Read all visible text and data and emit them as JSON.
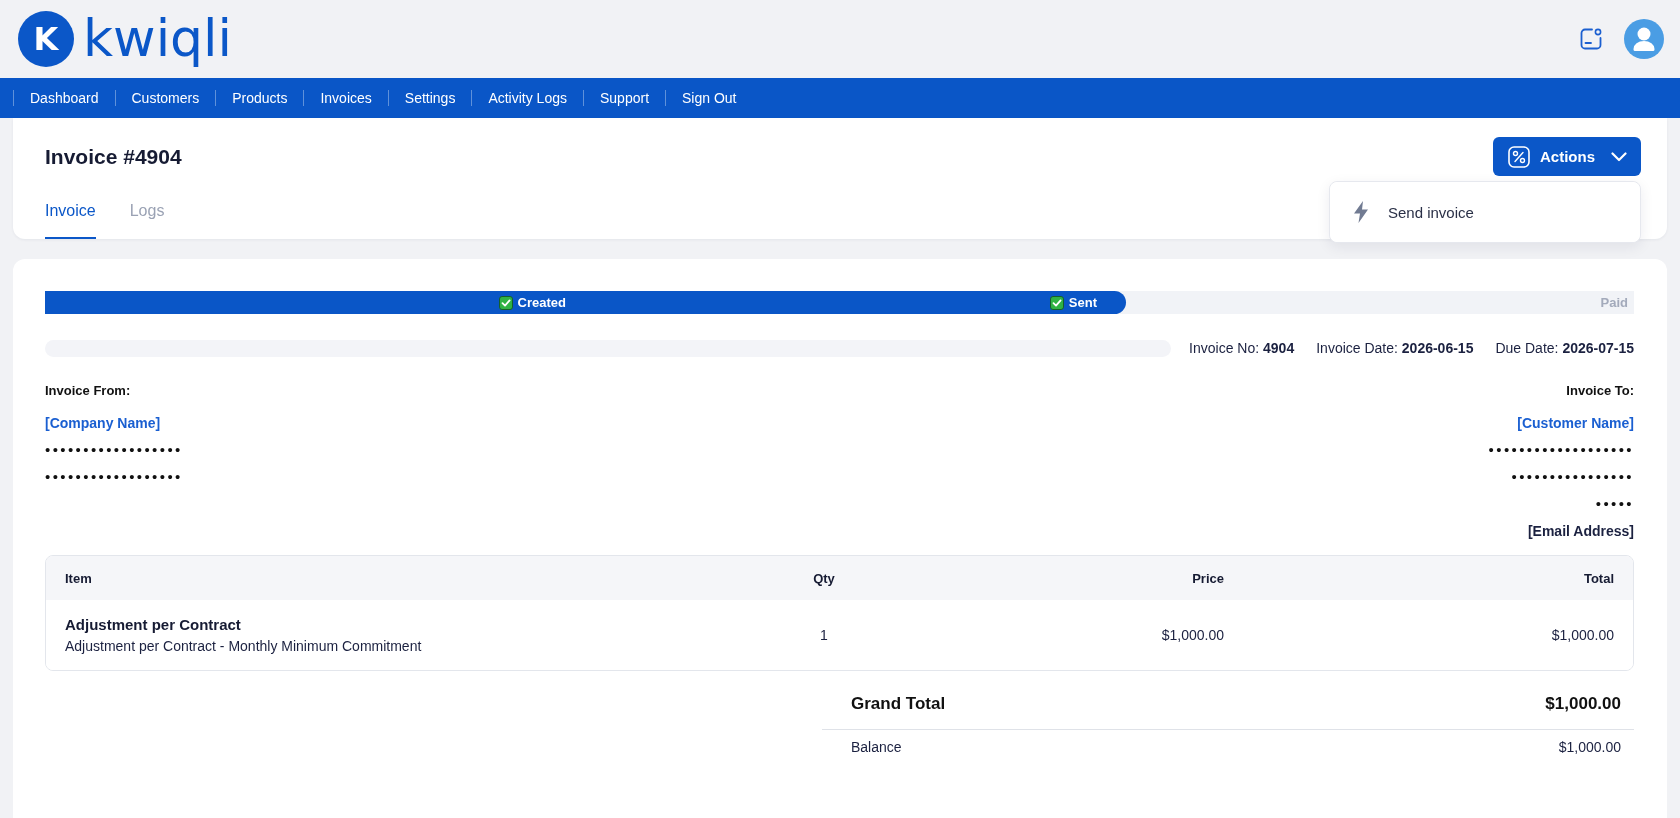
{
  "header": {
    "logo": {
      "mark": "K",
      "name": "kwiqli"
    }
  },
  "nav": [
    "Dashboard",
    "Customers",
    "Products",
    "Invoices",
    "Settings",
    "Activity Logs",
    "Support",
    "Sign Out"
  ],
  "page": {
    "title": "Invoice #4904",
    "tabs": [
      {
        "label": "Invoice",
        "selected": true
      },
      {
        "label": "Logs",
        "selected": false
      }
    ],
    "actions_button": "Actions",
    "actions_menu": {
      "open": true,
      "items": [
        "Send invoice"
      ]
    }
  },
  "progress": {
    "level": 0.68,
    "steps": [
      {
        "label": "Created",
        "done": true
      },
      {
        "label": "Sent",
        "done": true
      },
      {
        "label": "Paid",
        "done": false
      }
    ]
  },
  "meta": [
    "Invoice No: **4904**",
    "Invoice Date: **2026-06-15**",
    "Due Date: **2026-07-15**"
  ],
  "invoice_from": {
    "heading": "Invoice From:",
    "name": "[Company Name]",
    "lines": [
      "••••••••••••••••••",
      "••••••••••••••••••"
    ]
  },
  "invoice_to": {
    "heading": "Invoice To:",
    "name": "[Customer Name]",
    "lines": [
      "•••••••••••••••••••",
      "••••••••••••••••",
      "•••••"
    ],
    "email": "[Email Address]"
  },
  "table": {
    "columns": [
      "Item",
      "Qty",
      "Price",
      "Total"
    ],
    "rows": [
      {
        "item": "Adjustment per Contract",
        "description": "Adjustment per Contract - Monthly Minimum Commitment",
        "qty": "1",
        "price": "$1,000.00",
        "total": "$1,000.00"
      }
    ]
  },
  "totals": [
    {
      "kind": "grand",
      "label": "Grand Total",
      "value": "$1,000.00"
    },
    {
      "kind": "balance",
      "label": "Balance",
      "value": "$1,000.00"
    }
  ]
}
